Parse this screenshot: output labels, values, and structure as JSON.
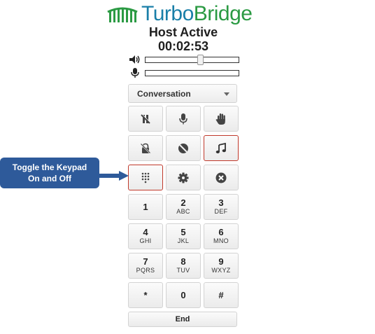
{
  "brand": {
    "part1": "Turbo",
    "part2": "Bridge"
  },
  "status": {
    "title": "Host Active",
    "timer": "00:02:53"
  },
  "audio": {
    "speaker_level": 0.6,
    "mic_level": 0.0
  },
  "mode_select": {
    "selected": "Conversation"
  },
  "control_buttons": [
    {
      "name": "mute-all-icon"
    },
    {
      "name": "microphone-icon"
    },
    {
      "name": "raise-hand-icon"
    },
    {
      "name": "lock-icon"
    },
    {
      "name": "block-icon"
    },
    {
      "name": "music-icon",
      "active": true
    },
    {
      "name": "keypad-icon",
      "active": true
    },
    {
      "name": "gear-icon"
    },
    {
      "name": "close-icon"
    }
  ],
  "keypad": [
    {
      "digit": "1",
      "letters": ""
    },
    {
      "digit": "2",
      "letters": "ABC"
    },
    {
      "digit": "3",
      "letters": "DEF"
    },
    {
      "digit": "4",
      "letters": "GHI"
    },
    {
      "digit": "5",
      "letters": "JKL"
    },
    {
      "digit": "6",
      "letters": "MNO"
    },
    {
      "digit": "7",
      "letters": "PQRS"
    },
    {
      "digit": "8",
      "letters": "TUV"
    },
    {
      "digit": "9",
      "letters": "WXYZ"
    },
    {
      "digit": "*",
      "letters": ""
    },
    {
      "digit": "0",
      "letters": ""
    },
    {
      "digit": "#",
      "letters": ""
    }
  ],
  "end_label": "End",
  "callout": {
    "line1": "Toggle the Keypad",
    "line2": "On and Off"
  },
  "colors": {
    "brand_blue": "#1a7fa8",
    "brand_green": "#2b9a43",
    "active_border": "#c0392b",
    "callout_bg": "#2e5a9a"
  }
}
